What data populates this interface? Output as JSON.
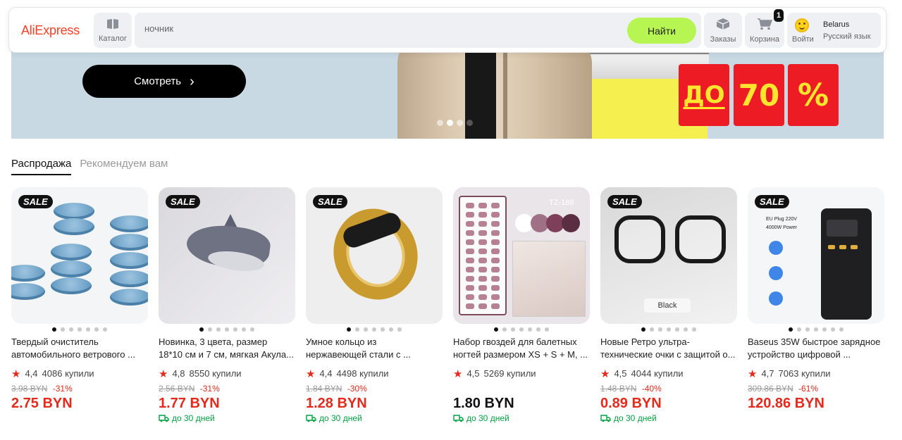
{
  "header": {
    "logo": "AliExpress",
    "catalog_label": "Каталог",
    "search_value": "ночник",
    "search_button": "Найти",
    "orders_label": "Заказы",
    "cart_label": "Корзина",
    "cart_count": "1",
    "login_label": "Войти",
    "country": "Belarus",
    "language": "Русский язык"
  },
  "banner": {
    "watch_button": "Смотреть",
    "promo_do": "ДО",
    "promo_number": "70",
    "promo_percent": "%"
  },
  "tabs": [
    {
      "label": "Распродажа",
      "active": true
    },
    {
      "label": "Рекомендуем вам",
      "active": false
    }
  ],
  "products": [
    {
      "title_line1": "Твердый очиститель",
      "title_line2": "автомобильного ветрового ...",
      "sale": "SALE",
      "rating": "4,4",
      "sold": "4086 купили",
      "old_price": "3.98 BYN",
      "discount": "-31%",
      "price": "2.75 BYN",
      "shipping": ""
    },
    {
      "title_line1": "Новинка, 3 цвета, размер",
      "title_line2": "18*10 см и 7 см, мягкая Акула...",
      "sale": "SALE",
      "rating": "4,8",
      "sold": "8550 купили",
      "old_price": "2.56 BYN",
      "discount": "-31%",
      "price": "1.77 BYN",
      "shipping": "до 30 дней"
    },
    {
      "title_line1": "Умное кольцо из",
      "title_line2": "нержавеющей стали с ...",
      "sale": "SALE",
      "rating": "4,4",
      "sold": "4498 купили",
      "old_price": "1.84 BYN",
      "discount": "-30%",
      "price": "1.28 BYN",
      "shipping": "до 30 дней"
    },
    {
      "title_line1": "Набор гвоздей для балетных",
      "title_line2": "ногтей размером XS + S + M, ...",
      "sale": "",
      "image_text": "TZ-188",
      "rating": "4,5",
      "sold": "5269 купили",
      "old_price": "",
      "discount": "",
      "price": "1.80 BYN",
      "shipping": "до 30 дней"
    },
    {
      "title_line1": "Новые Ретро ультра-",
      "title_line2": "технические очки с защитой о...",
      "sale": "SALE",
      "image_text": "Black",
      "rating": "4,5",
      "sold": "4044 купили",
      "old_price": "1.48 BYN",
      "discount": "-40%",
      "price": "0.89 BYN",
      "shipping": "до 30 дней"
    },
    {
      "title_line1": "Baseus 35W быстрое зарядное",
      "title_line2": "устройство цифровой ...",
      "sale": "SALE",
      "image_text": "EU Plug 220V",
      "image_text2": "4000W Power",
      "rating": "4,7",
      "sold": "7063 купили",
      "old_price": "309.86 BYN",
      "discount": "-61%",
      "price": "120.86 BYN",
      "shipping": ""
    }
  ],
  "colors": {
    "brand": "#ff3d23",
    "search_button": "#b7f552",
    "price_red": "#e5291c",
    "shipping_green": "#00a341"
  },
  "icons": {
    "catalog": "book-icon",
    "orders": "box-icon",
    "cart": "cart-icon",
    "login": "smile-icon",
    "rating": "star-icon",
    "shipping": "truck-icon"
  }
}
